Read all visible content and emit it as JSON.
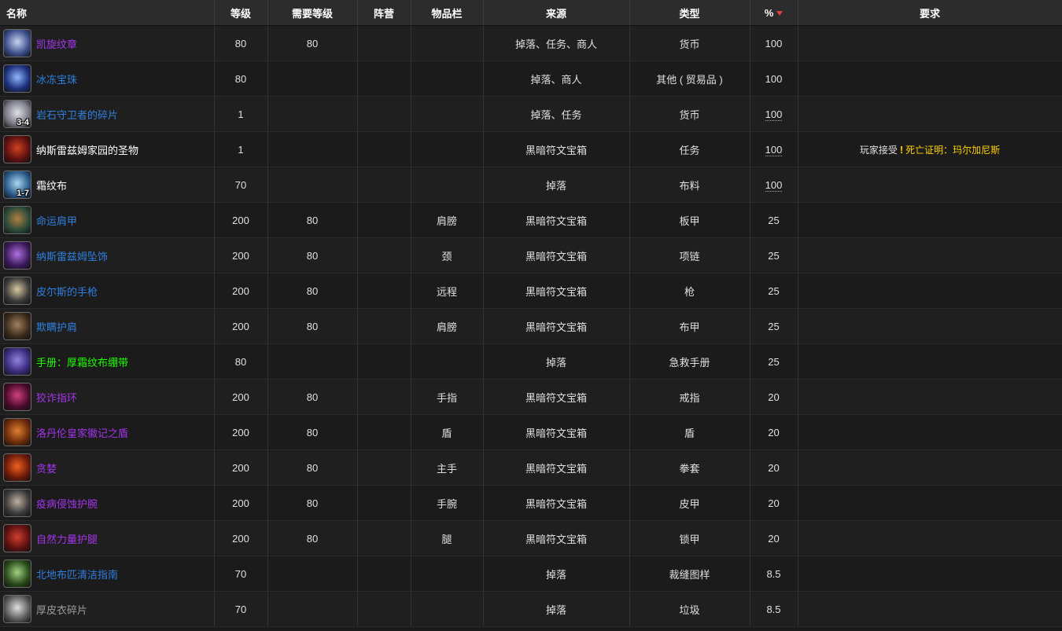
{
  "headers": {
    "name": "名称",
    "level": "等级",
    "req_level": "需要等级",
    "faction": "阵营",
    "slot": "物品栏",
    "source": "来源",
    "type": "类型",
    "percent": "%",
    "requirement": "要求"
  },
  "rows": [
    {
      "name": "凯旋纹章",
      "quality": "epic",
      "level": "80",
      "req_level": "80",
      "faction": "",
      "slot": "",
      "source": "掉落、任务、商人",
      "type": "货币",
      "percent": "100",
      "icon": "emblem-of-triumph-icon",
      "icon_colors": [
        "#3b4f8a",
        "#c9d3f0"
      ],
      "count": ""
    },
    {
      "name": "冰冻宝珠",
      "quality": "rare",
      "level": "80",
      "req_level": "",
      "faction": "",
      "slot": "",
      "source": "掉落、商人",
      "type": "其他 ( 贸易品 )",
      "percent": "100",
      "icon": "frozen-orb-icon",
      "icon_colors": [
        "#1c2f7a",
        "#8fb6ff"
      ],
      "count": ""
    },
    {
      "name": "岩石守卫者的碎片",
      "quality": "rare",
      "level": "1",
      "req_level": "",
      "faction": "",
      "slot": "",
      "source": "掉落、任务",
      "type": "货币",
      "percent": "100",
      "icon": "stone-keeper-shard-icon",
      "icon_colors": [
        "#7a7a86",
        "#e0e0e8"
      ],
      "count": "3-4"
    },
    {
      "name": "纳斯雷兹姆家园的圣物",
      "quality": "common",
      "level": "1",
      "req_level": "",
      "faction": "",
      "slot": "",
      "source": "黑暗符文宝箱",
      "type": "任务",
      "percent": "100",
      "icon": "relic-icon",
      "icon_colors": [
        "#5a1010",
        "#d04020"
      ],
      "count": "",
      "requirement_prefix": "玩家接受",
      "requirement_quest": "死亡证明：玛尔加尼斯"
    },
    {
      "name": "霜纹布",
      "quality": "common",
      "level": "70",
      "req_level": "",
      "faction": "",
      "slot": "",
      "source": "掉落",
      "type": "布料",
      "percent": "100",
      "icon": "frostweave-cloth-icon",
      "icon_colors": [
        "#2a5a8a",
        "#a8d8f0"
      ],
      "count": "1-7"
    },
    {
      "name": "命运肩甲",
      "quality": "rare",
      "level": "200",
      "req_level": "80",
      "faction": "",
      "slot": "肩膀",
      "source": "黑暗符文宝箱",
      "type": "板甲",
      "percent": "25",
      "icon": "shoulder-plate-icon",
      "icon_colors": [
        "#2a4a3a",
        "#b08040"
      ],
      "count": ""
    },
    {
      "name": "纳斯雷兹姆坠饰",
      "quality": "rare",
      "level": "200",
      "req_level": "80",
      "faction": "",
      "slot": "颈",
      "source": "黑暗符文宝箱",
      "type": "项链",
      "percent": "25",
      "icon": "pendant-icon",
      "icon_colors": [
        "#3a1a5a",
        "#b070e0"
      ],
      "count": ""
    },
    {
      "name": "皮尔斯的手枪",
      "quality": "rare",
      "level": "200",
      "req_level": "80",
      "faction": "",
      "slot": "远程",
      "source": "黑暗符文宝箱",
      "type": "枪",
      "percent": "25",
      "icon": "pistol-icon",
      "icon_colors": [
        "#3a3a3a",
        "#d8c8a0"
      ],
      "count": ""
    },
    {
      "name": "欺瞒护肩",
      "quality": "rare",
      "level": "200",
      "req_level": "80",
      "faction": "",
      "slot": "肩膀",
      "source": "黑暗符文宝箱",
      "type": "布甲",
      "percent": "25",
      "icon": "cloth-shoulder-icon",
      "icon_colors": [
        "#3a2a1a",
        "#a08060"
      ],
      "count": ""
    },
    {
      "name": "手册：厚霜纹布绷带",
      "quality": "uncommon",
      "level": "80",
      "req_level": "",
      "faction": "",
      "slot": "",
      "source": "掉落",
      "type": "急救手册",
      "percent": "25",
      "icon": "manual-book-icon",
      "icon_colors": [
        "#3a2a7a",
        "#9080e0"
      ],
      "count": ""
    },
    {
      "name": "狡诈指环",
      "quality": "epic",
      "level": "200",
      "req_level": "80",
      "faction": "",
      "slot": "手指",
      "source": "黑暗符文宝箱",
      "type": "戒指",
      "percent": "20",
      "icon": "ring-icon",
      "icon_colors": [
        "#4a0a2a",
        "#d04080"
      ],
      "count": ""
    },
    {
      "name": "洛丹伦皇家徽记之盾",
      "quality": "epic",
      "level": "200",
      "req_level": "80",
      "faction": "",
      "slot": "盾",
      "source": "黑暗符文宝箱",
      "type": "盾",
      "percent": "20",
      "icon": "shield-icon",
      "icon_colors": [
        "#6a2a0a",
        "#e08030"
      ],
      "count": ""
    },
    {
      "name": "贪婪",
      "quality": "epic",
      "level": "200",
      "req_level": "80",
      "faction": "",
      "slot": "主手",
      "source": "黑暗符文宝箱",
      "type": "拳套",
      "percent": "20",
      "icon": "fist-weapon-icon",
      "icon_colors": [
        "#6a1a0a",
        "#f06020"
      ],
      "count": ""
    },
    {
      "name": "疫病侵蚀护腕",
      "quality": "epic",
      "level": "200",
      "req_level": "80",
      "faction": "",
      "slot": "手腕",
      "source": "黑暗符文宝箱",
      "type": "皮甲",
      "percent": "20",
      "icon": "bracer-icon",
      "icon_colors": [
        "#3a3a3a",
        "#c0b0a0"
      ],
      "count": ""
    },
    {
      "name": "自然力量护腿",
      "quality": "epic",
      "level": "200",
      "req_level": "80",
      "faction": "",
      "slot": "腿",
      "source": "黑暗符文宝箱",
      "type": "锁甲",
      "percent": "20",
      "icon": "leggings-icon",
      "icon_colors": [
        "#5a1010",
        "#d04030"
      ],
      "count": ""
    },
    {
      "name": "北地布匹清洁指南",
      "quality": "rare",
      "level": "70",
      "req_level": "",
      "faction": "",
      "slot": "",
      "source": "掉落",
      "type": "裁缝图样",
      "percent": "8.5",
      "icon": "pattern-book-icon",
      "icon_colors": [
        "#2a4a1a",
        "#a0d080"
      ],
      "count": ""
    },
    {
      "name": "厚皮衣碎片",
      "quality": "poor",
      "level": "70",
      "req_level": "",
      "faction": "",
      "slot": "",
      "source": "掉落",
      "type": "垃圾",
      "percent": "8.5",
      "icon": "leather-scrap-icon",
      "icon_colors": [
        "#5a5a5a",
        "#e0e0e0"
      ],
      "count": ""
    }
  ]
}
